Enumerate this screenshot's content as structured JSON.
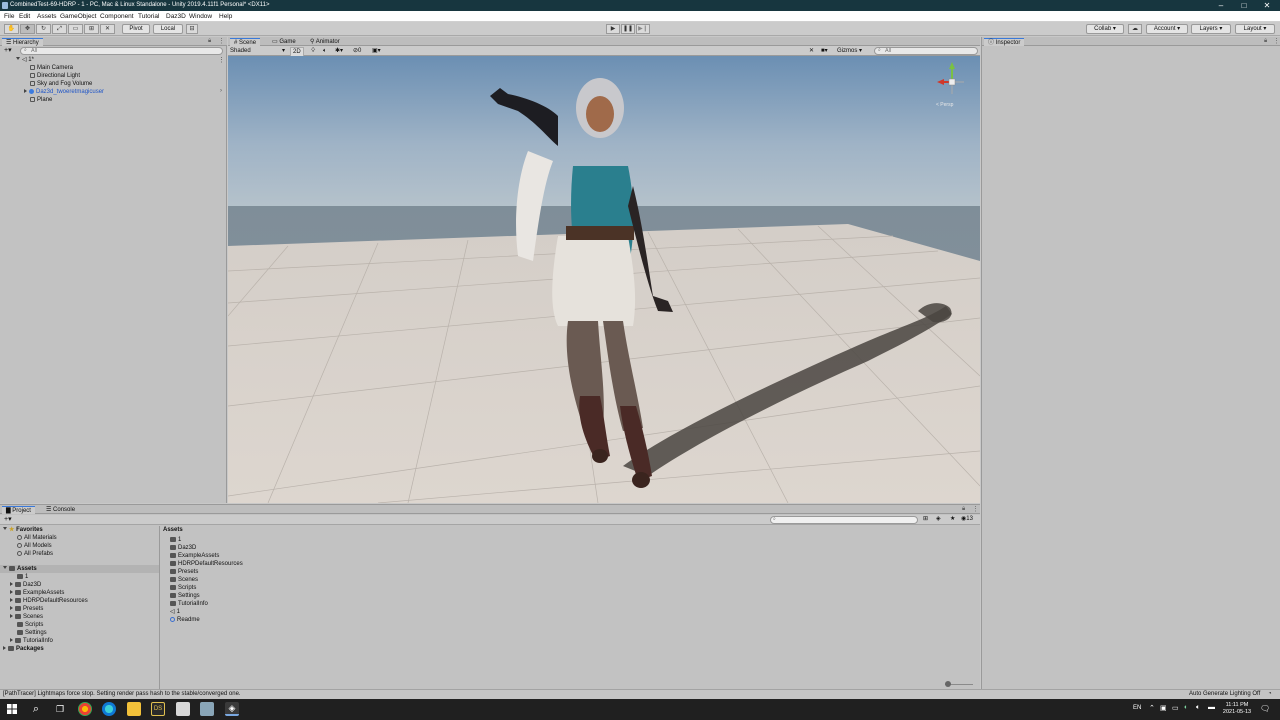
{
  "window": {
    "title": "CombinedTest-69-HDRP - 1 - PC, Mac & Linux Standalone - Unity 2019.4.11f1 Personal* <DX11>",
    "minimize_icon": "minimize-icon",
    "maximize_icon": "maximize-icon",
    "close_icon": "close-icon"
  },
  "menu": [
    "File",
    "Edit",
    "Assets",
    "GameObject",
    "Component",
    "Tutorial",
    "Daz3D",
    "Window",
    "Help"
  ],
  "toolbar": {
    "pivot_label": "Pivot",
    "local_label": "Local",
    "collab_label": "Collab",
    "account_label": "Account",
    "layers_label": "Layers",
    "layout_label": "Layout"
  },
  "hierarchy": {
    "tab_label": "Hierarchy",
    "search_placeholder": "All",
    "scene_name": "1*",
    "items": [
      "Main Camera",
      "Directional Light",
      "Sky and Fog Volume",
      "Daz3d_twoeretmagicuser",
      "Plane"
    ]
  },
  "scene_view": {
    "tabs": [
      "Scene",
      "Game",
      "Animator"
    ],
    "shading_mode": "Shaded",
    "mode_2d": "2D",
    "gizmos_label": "Gizmos",
    "search_placeholder": "All",
    "visibility_count": "0",
    "persp_label": "< Persp"
  },
  "inspector": {
    "tab_label": "Inspector"
  },
  "project": {
    "tabs": [
      "Project",
      "Console"
    ],
    "favorites_label": "Favorites",
    "favorites": [
      "All Materials",
      "All Models",
      "All Prefabs"
    ],
    "assets_label": "Assets",
    "asset_folders": [
      "1",
      "Daz3D",
      "ExampleAssets",
      "HDRPDefaultResources",
      "Presets",
      "Scenes",
      "Scripts",
      "Settings",
      "TutorialInfo"
    ],
    "packages_label": "Packages",
    "breadcrumb": "Assets",
    "grid_items": [
      "1",
      "Daz3D",
      "ExampleAssets",
      "HDRPDefaultResources",
      "Presets",
      "Scenes",
      "Scripts",
      "Settings",
      "TutorialInfo",
      "1",
      "Readme"
    ],
    "hidden_count": "13"
  },
  "status": {
    "message": "[PathTracer] Lightmaps force stop. Setting render pass hash to the stable/converged one.",
    "right_message": "Auto Generate Lighting Off"
  },
  "taskbar": {
    "language": "EN",
    "time": "11:11 PM",
    "date": "2021-05-13"
  },
  "colors": {
    "title_bar": "#17363f",
    "selected_item_text": "#1f55c7",
    "active_tab_accent": "#3a79d9",
    "sky_top": "#6b8fb3",
    "floor": "#d9d2cb",
    "taskbar": "#202020"
  }
}
